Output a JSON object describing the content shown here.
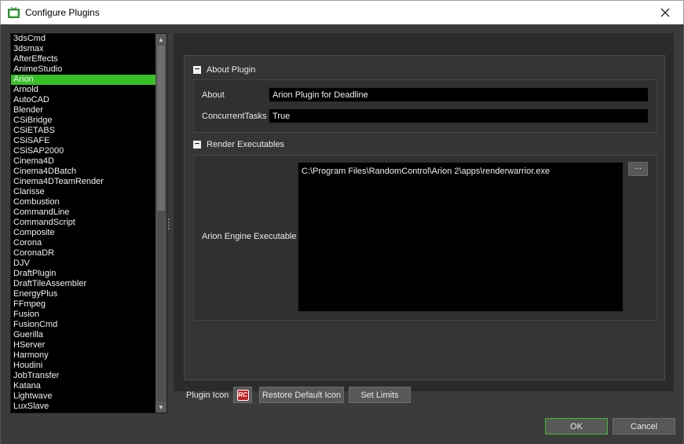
{
  "window": {
    "title": "Configure Plugins",
    "close_icon": "close-icon",
    "app_icon": "tv-icon"
  },
  "plugin_list": {
    "items": [
      "3dsCmd",
      "3dsmax",
      "AfterEffects",
      "AnimeStudio",
      "Arion",
      "Arnold",
      "AutoCAD",
      "Blender",
      "CSiBridge",
      "CSiETABS",
      "CSiSAFE",
      "CSiSAP2000",
      "Cinema4D",
      "Cinema4DBatch",
      "Cinema4DTeamRender",
      "Clarisse",
      "Combustion",
      "CommandLine",
      "CommandScript",
      "Composite",
      "Corona",
      "CoronaDR",
      "DJV",
      "DraftPlugin",
      "DraftTileAssembler",
      "EnergyPlus",
      "FFmpeg",
      "Fusion",
      "FusionCmd",
      "Guerilla",
      "HServer",
      "Harmony",
      "Houdini",
      "JobTransfer",
      "Katana",
      "Lightwave",
      "LuxSlave"
    ],
    "selected": "Arion",
    "selected_color": "#35c126"
  },
  "about_plugin": {
    "header": "About Plugin",
    "about_label": "About",
    "about_value": "Arion Plugin for Deadline",
    "concurrent_label": "ConcurrentTasks",
    "concurrent_value": "True"
  },
  "render_executables": {
    "header": "Render Executables",
    "exe_label": "Arion Engine Executable",
    "exe_value": "C:\\Program Files\\RandomControl\\Arion 2\\apps\\renderwarrior.exe",
    "browse_label": "..."
  },
  "footer": {
    "plugin_icon_label": "Plugin Icon",
    "plugin_icon_text": "RC",
    "restore_label": "Restore Default Icon",
    "set_limits_label": "Set Limits",
    "ok_label": "OK",
    "cancel_label": "Cancel"
  }
}
